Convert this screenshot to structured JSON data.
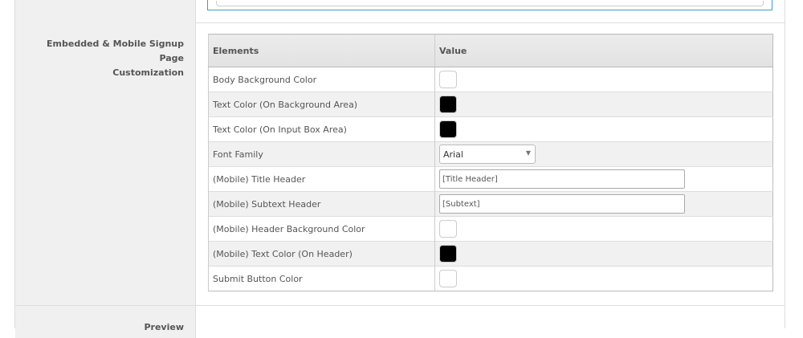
{
  "section": {
    "label_line1": "Embedded & Mobile Signup Page",
    "label_line2": "Customization"
  },
  "table": {
    "headers": [
      "Elements",
      "Value"
    ],
    "rows": [
      {
        "element": "Body Background Color",
        "type": "color",
        "color": "#ffffff"
      },
      {
        "element": "Text Color (On Background Area)",
        "type": "color",
        "color": "#000000"
      },
      {
        "element": "Text Color (On Input Box Area)",
        "type": "color",
        "color": "#000000"
      },
      {
        "element": "Font Family",
        "type": "select",
        "value": "Arial"
      },
      {
        "element": "(Mobile) Title Header",
        "type": "text",
        "value": "[Title Header]"
      },
      {
        "element": "(Mobile) Subtext Header",
        "type": "text",
        "value": "[Subtext]"
      },
      {
        "element": "(Mobile) Header Background Color",
        "type": "color",
        "color": "#ffffff"
      },
      {
        "element": "(Mobile) Text Color (On Header)",
        "type": "color",
        "color": "#000000"
      },
      {
        "element": "Submit Button Color",
        "type": "color",
        "color": "#ffffff"
      }
    ]
  },
  "preview": {
    "label": "Preview"
  },
  "colors": {
    "label_bg": "#f0f0f0",
    "row_alt": "#f1f1f1",
    "accent_border": "#3aa0c8"
  }
}
